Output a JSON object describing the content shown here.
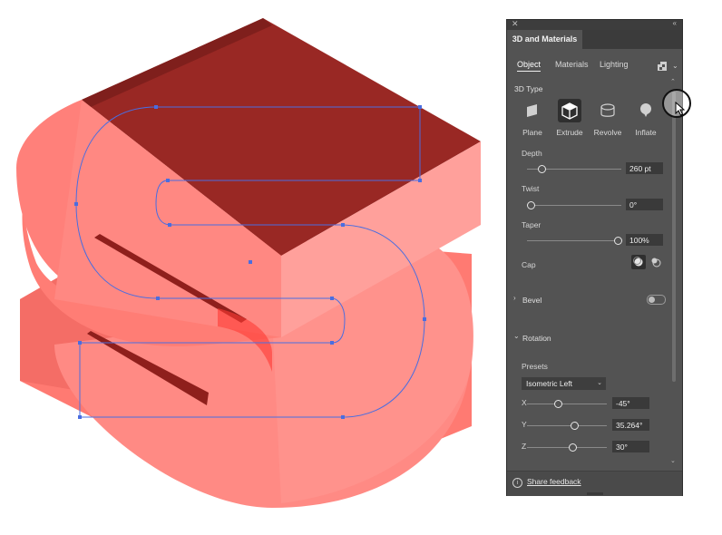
{
  "panel": {
    "title": "3D and Materials",
    "subtabs": [
      "Object",
      "Materials",
      "Lighting"
    ],
    "section_3d_type": "3D Type",
    "types": [
      {
        "label": "Plane",
        "icon": "plane-icon"
      },
      {
        "label": "Extrude",
        "icon": "extrude-icon"
      },
      {
        "label": "Revolve",
        "icon": "revolve-icon"
      },
      {
        "label": "Inflate",
        "icon": "inflate-icon"
      }
    ],
    "depth": {
      "label": "Depth",
      "value": "260 pt",
      "level": 0.1
    },
    "twist": {
      "label": "Twist",
      "value": "0°",
      "level": 0.0
    },
    "taper": {
      "label": "Taper",
      "value": "100%",
      "level": 1.0
    },
    "cap_label": "Cap",
    "bevel_label": "Bevel",
    "rotation_label": "Rotation",
    "presets_label": "Presets",
    "preset_value": "Isometric Left",
    "rotation_axes": [
      {
        "axis": "X",
        "value": "-45°",
        "level": 0.375
      },
      {
        "axis": "Y",
        "value": "35.264°",
        "level": 0.6
      },
      {
        "axis": "Z",
        "value": "30°",
        "level": 0.58
      }
    ],
    "feedback_text": "Share feedback",
    "info_glyph": "i"
  },
  "colors": {
    "extrude_top": "#9a2a26",
    "extrude_face": "#ff8079",
    "selection": "#4a6de0",
    "panel_bg": "#535353"
  }
}
